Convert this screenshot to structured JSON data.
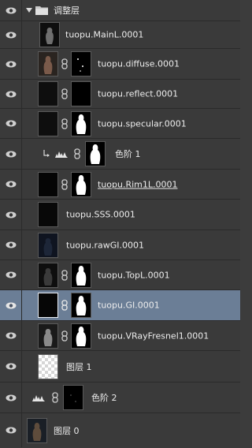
{
  "group": {
    "name": "调整层"
  },
  "layers": [
    {
      "id": "mainl",
      "label": "tuopu.MainL.0001"
    },
    {
      "id": "diffuse",
      "label": "tuopu.diffuse.0001"
    },
    {
      "id": "reflect",
      "label": "tuopu.reflect.0001"
    },
    {
      "id": "specular",
      "label": "tuopu.specular.0001"
    },
    {
      "id": "levels1",
      "label": "色阶 1"
    },
    {
      "id": "rim1l",
      "label": "tuopu.Rim1L.0001"
    },
    {
      "id": "sss",
      "label": "tuopu.SSS.0001"
    },
    {
      "id": "rawgi",
      "label": "tuopu.rawGI.0001"
    },
    {
      "id": "topl",
      "label": "tuopu.TopL.0001"
    },
    {
      "id": "gi",
      "label": "tuopu.GI.0001"
    },
    {
      "id": "vrayfresnel",
      "label": "tuopu.VRayFresnel1.0001"
    },
    {
      "id": "layer1",
      "label": "图层 1"
    },
    {
      "id": "levels2",
      "label": "色阶 2"
    },
    {
      "id": "layer0",
      "label": "图层 0"
    }
  ],
  "colors": {
    "panel": "#3a3a3a",
    "selected": "#6b7e96",
    "divider": "#2a2a2a",
    "text": "#ececec"
  }
}
